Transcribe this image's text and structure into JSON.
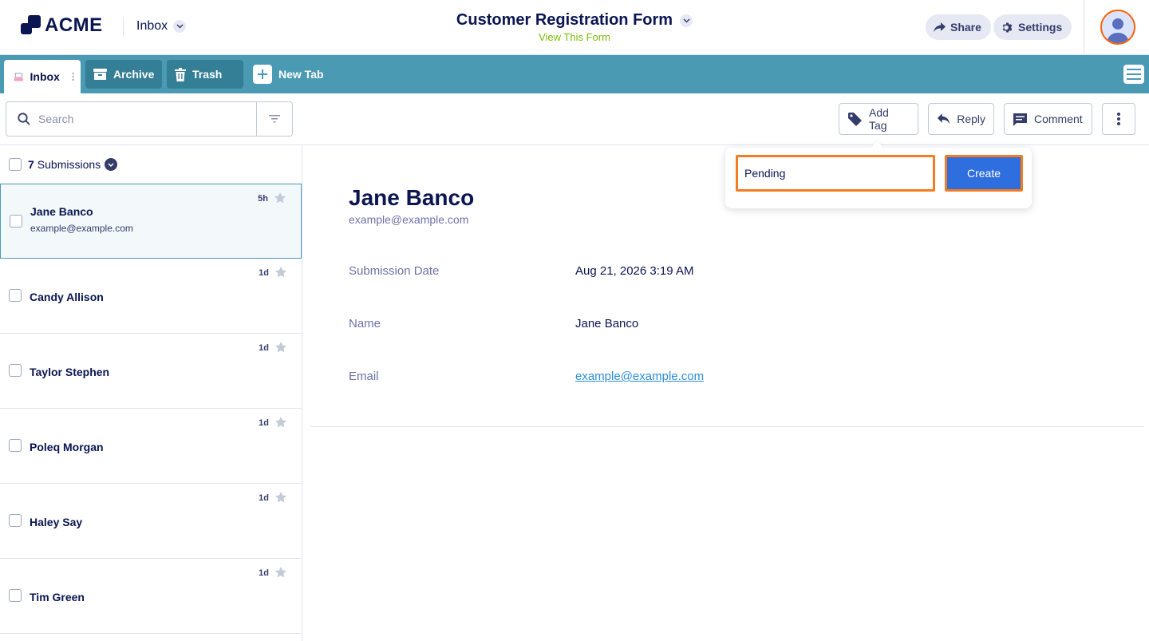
{
  "brand": {
    "logo_text": "ACME"
  },
  "header": {
    "inbox_label": "Inbox",
    "form_title": "Customer Registration Form",
    "form_link": "View This Form",
    "share_label": "Share",
    "settings_label": "Settings"
  },
  "tabs": [
    {
      "label": "Inbox",
      "icon": "inbox-icon",
      "active": true
    },
    {
      "label": "Archive",
      "icon": "archive-icon",
      "active": false
    },
    {
      "label": "Trash",
      "icon": "trash-icon",
      "active": false
    }
  ],
  "new_tab_label": "New Tab",
  "toolbar": {
    "search_placeholder": "Search",
    "add_tag_label": "Add Tag",
    "reply_label": "Reply",
    "comment_label": "Comment"
  },
  "list": {
    "count": "7",
    "count_label": "Submissions",
    "items": [
      {
        "name": "Jane Banco",
        "email": "example@example.com",
        "time": "5h",
        "selected": true
      },
      {
        "name": "Candy Allison",
        "email": "",
        "time": "1d",
        "selected": false
      },
      {
        "name": "Taylor Stephen",
        "email": "",
        "time": "1d",
        "selected": false
      },
      {
        "name": "Poleq Morgan",
        "email": "",
        "time": "1d",
        "selected": false
      },
      {
        "name": "Haley Say",
        "email": "",
        "time": "1d",
        "selected": false
      },
      {
        "name": "Tim Green",
        "email": "",
        "time": "1d",
        "selected": false
      }
    ]
  },
  "detail": {
    "name": "Jane Banco",
    "email": "example@example.com",
    "fields": [
      {
        "label": "Submission Date",
        "value": "Aug 21, 2026 3:19 AM"
      },
      {
        "label": "Name",
        "value": "Jane Banco"
      },
      {
        "label": "Email",
        "value": "example@example.com"
      }
    ]
  },
  "tag_popover": {
    "input_value": "Pending",
    "create_label": "Create"
  },
  "colors": {
    "navy": "#0a1551",
    "tabbar": "#4b9ab4",
    "tab_dark": "#357f96",
    "primary_button": "#2f6ede",
    "highlight": "#f47c20",
    "link": "#2e8ed9",
    "form_link": "#78bb07"
  }
}
